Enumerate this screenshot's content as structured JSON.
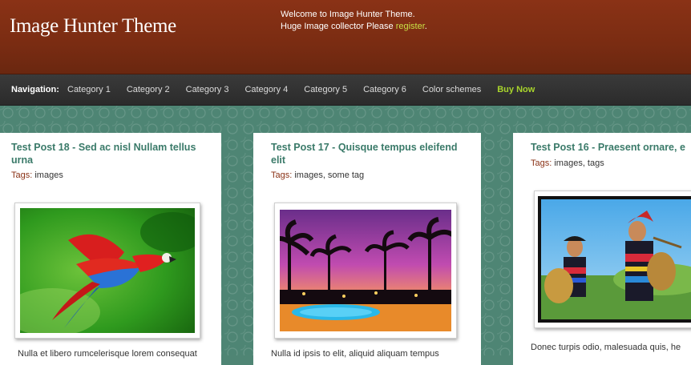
{
  "header": {
    "site_title": "Image Hunter Theme",
    "welcome_line1": "Welcome to Image Hunter Theme.",
    "welcome_line2": "Huge Image collector Please ",
    "register_link": "register",
    "welcome_suffix": "."
  },
  "nav": {
    "label": "Navigation:",
    "items": [
      "Category 1",
      "Category 2",
      "Category 3",
      "Category 4",
      "Category 5",
      "Category 6",
      "Color schemes"
    ],
    "buy_now": "Buy Now"
  },
  "posts": [
    {
      "title": "Test Post 18 - Sed ac nisl Nullam tellus urna",
      "tags_label": "Tags:",
      "tags": " images",
      "image": "parrot-photo",
      "excerpt": "Nulla et libero rumcelerisque lorem consequat"
    },
    {
      "title": "Test Post 17 - Quisque tempus eleifend elit",
      "tags_label": "Tags:",
      "tags": " images, some tag",
      "image": "tropical-resort-photo",
      "excerpt": "Nulla id ipsis to elit, aliquid aliquam tempus"
    },
    {
      "title": "Test Post 16 - Praesent ornare, e",
      "tags_label": "Tags:",
      "tags": " images, tags",
      "image": "villagers-photo",
      "excerpt": "Donec turpis odio, malesuada quis, he"
    }
  ],
  "colors": {
    "header_brown": "#7a2c12",
    "nav_dark": "#2f2f2f",
    "title_green": "#3a7a69",
    "buy_green": "#a8d42c",
    "register_green": "#c8e046",
    "tag_label_red": "#8a3216"
  }
}
